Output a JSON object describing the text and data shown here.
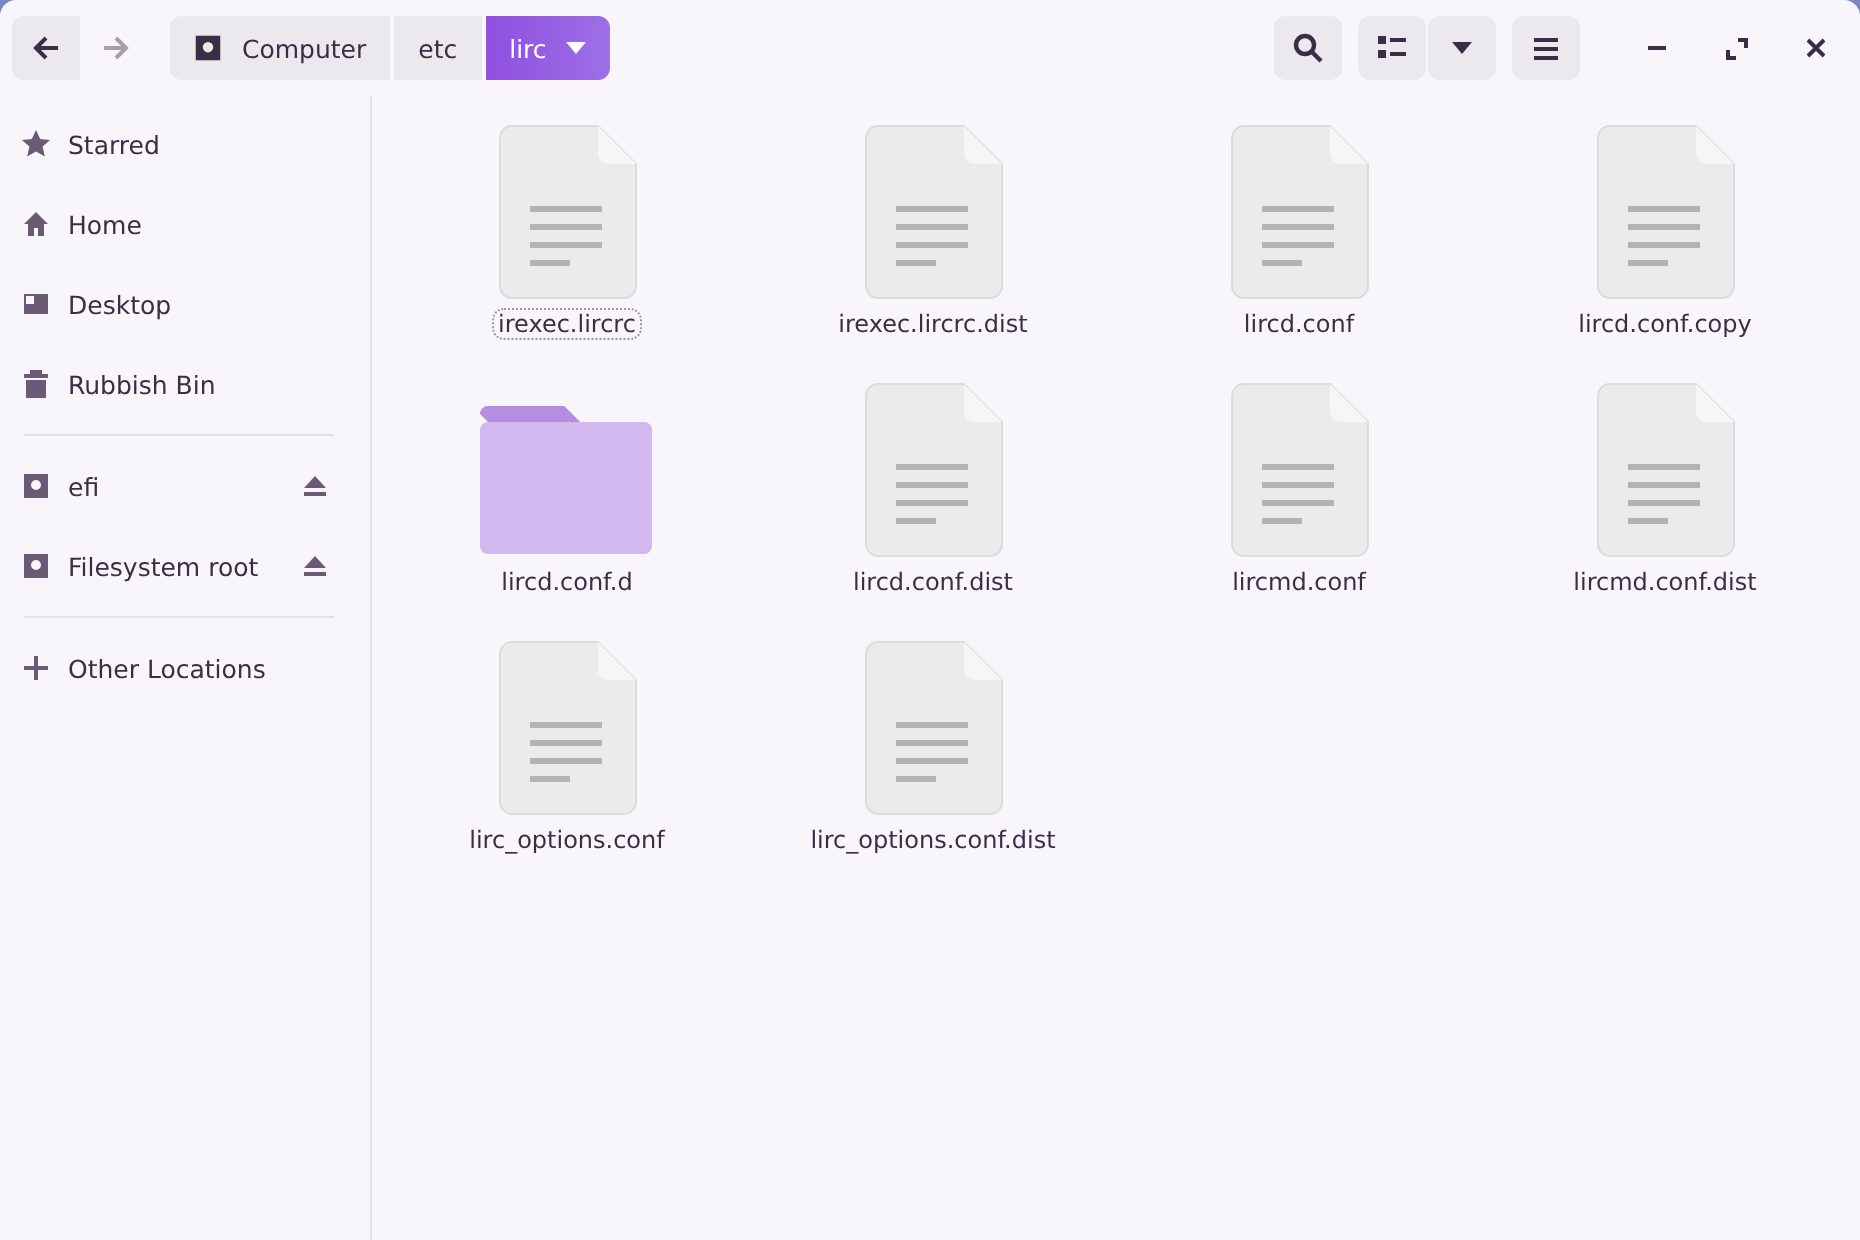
{
  "toolbar": {
    "back": {
      "disabled": false
    },
    "forward": {
      "disabled": true
    },
    "path": [
      {
        "label": "Computer",
        "kind": "drive",
        "selected": false
      },
      {
        "label": "etc",
        "kind": "folder",
        "selected": false
      },
      {
        "label": "lirc",
        "kind": "folder",
        "selected": true
      }
    ]
  },
  "sidebar": {
    "sections": [
      [
        {
          "label": "Starred",
          "kind": "star",
          "eject": false
        },
        {
          "label": "Home",
          "kind": "home",
          "eject": false
        },
        {
          "label": "Desktop",
          "kind": "desktop",
          "eject": false
        },
        {
          "label": "Rubbish Bin",
          "kind": "trash",
          "eject": false
        }
      ],
      [
        {
          "label": "efi",
          "kind": "drive",
          "eject": true
        },
        {
          "label": "Filesystem root",
          "kind": "drive",
          "eject": true
        }
      ],
      [
        {
          "label": "Other Locations",
          "kind": "plus",
          "eject": false
        }
      ]
    ]
  },
  "files": [
    {
      "name": "irexec.lircrc",
      "kind": "file",
      "focused": true
    },
    {
      "name": "irexec.lircrc.dist",
      "kind": "file",
      "focused": false
    },
    {
      "name": "lircd.conf",
      "kind": "file",
      "focused": false
    },
    {
      "name": "lircd.conf.copy",
      "kind": "file",
      "focused": false
    },
    {
      "name": "lircd.conf.d",
      "kind": "folder",
      "focused": false
    },
    {
      "name": "lircd.conf.dist",
      "kind": "file",
      "focused": false
    },
    {
      "name": "lircmd.conf",
      "kind": "file",
      "focused": false
    },
    {
      "name": "lircmd.conf.dist",
      "kind": "file",
      "focused": false
    },
    {
      "name": "lirc_options.conf",
      "kind": "file",
      "focused": false
    },
    {
      "name": "lirc_options.conf.dist",
      "kind": "file",
      "focused": false
    }
  ]
}
